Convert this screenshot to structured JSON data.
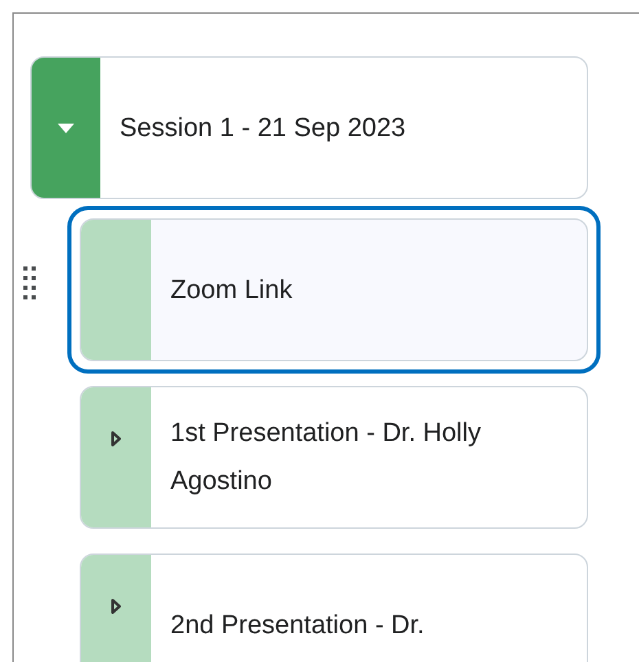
{
  "modules": [
    {
      "title": "Session 1 - 21 Sep 2023",
      "kind": "module",
      "expanded": true,
      "children": [
        {
          "title": "Zoom Link",
          "kind": "link",
          "selected": true
        },
        {
          "title": "1st Presentation - Dr. Holly Agostino",
          "kind": "module",
          "expanded": false,
          "selected": false
        },
        {
          "title": "2nd Presentation - Dr.",
          "kind": "module",
          "expanded": false,
          "selected": false
        }
      ]
    }
  ]
}
